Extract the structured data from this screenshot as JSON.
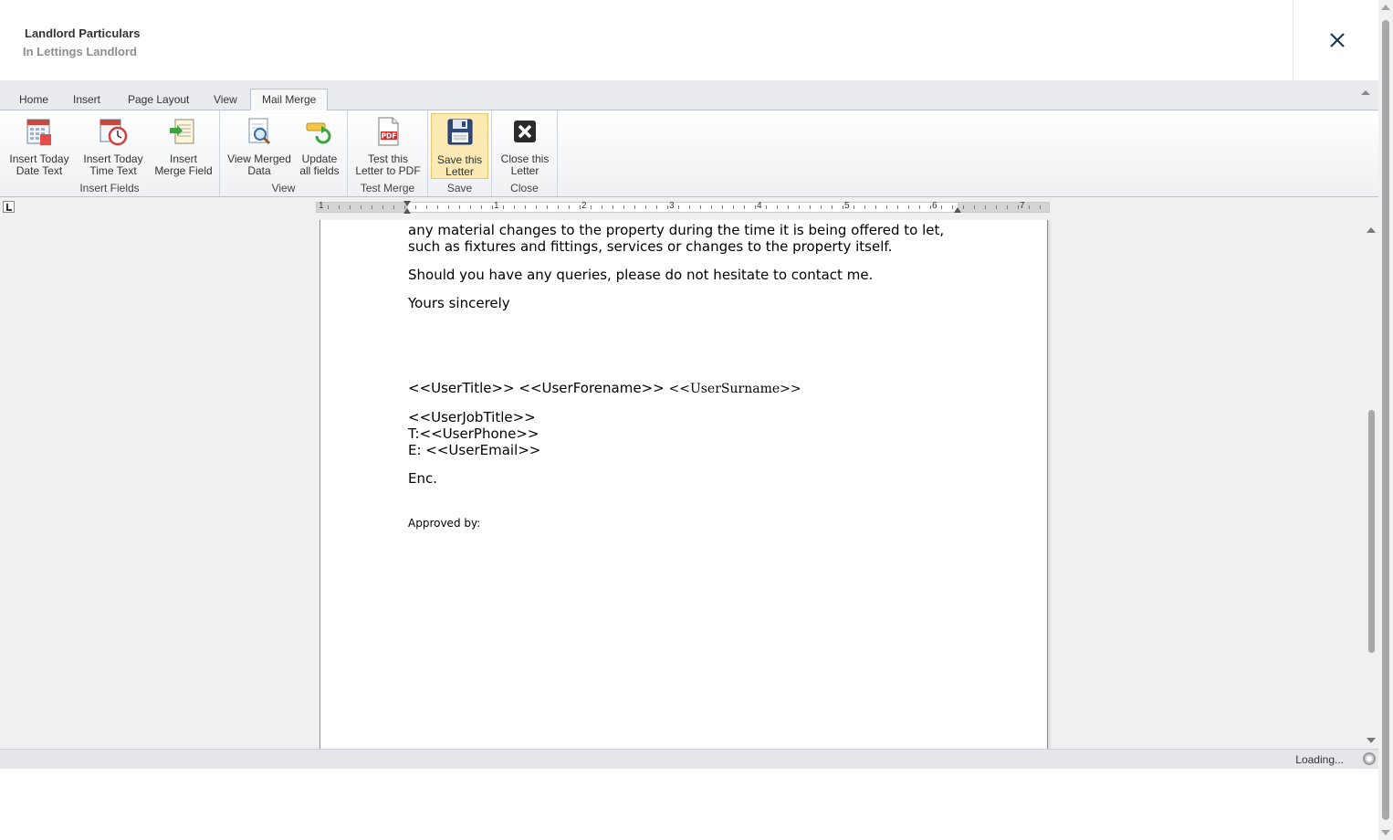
{
  "header": {
    "title": "Landlord Particulars",
    "subtitle": "In Lettings Landlord"
  },
  "tabs": [
    {
      "label": "Home"
    },
    {
      "label": "Insert"
    },
    {
      "label": "Page Layout"
    },
    {
      "label": "View"
    },
    {
      "label": "Mail Merge",
      "active": true
    }
  ],
  "ribbon": {
    "groups": {
      "insert_fields": "Insert Fields",
      "view": "View",
      "test_merge": "Test Merge",
      "save": "Save",
      "close": "Close"
    },
    "buttons": {
      "insert_date": "Insert Today\nDate Text",
      "insert_time": "Insert Today\nTime Text",
      "insert_merge": "Insert\nMerge Field",
      "view_merged": "View Merged\nData",
      "update_fields": "Update\nall fields",
      "test_pdf": "Test this\nLetter to PDF",
      "save_letter": "Save this\nLetter",
      "close_letter": "Close this\nLetter"
    },
    "pdf_icon_text": "PDF"
  },
  "ruler": {
    "numbers": [
      "1",
      "1",
      "2",
      "3",
      "4",
      "5",
      "6",
      "7"
    ]
  },
  "document": {
    "line1": "any material changes to the property during the time it is being offered to let,",
    "line2": "such as fixtures and fittings, services or changes to the property itself.",
    "line3": "Should you have any queries, please do not hesitate to contact me.",
    "line4": "Yours sincerely",
    "sig_title": "<<UserTitle>> <<UserForename>> ",
    "sig_surname": "<<UserSurname>>",
    "job_title": "<<UserJobTitle>>",
    "phone": "T:<<UserPhone>>",
    "email": "E: <<UserEmail>>",
    "enc": "Enc.",
    "approved": "Approved by:"
  },
  "status": {
    "text": "Loading..."
  },
  "colors": {
    "accent_highlight": "#fbeab3",
    "tab_bar": "#e9ebef"
  }
}
